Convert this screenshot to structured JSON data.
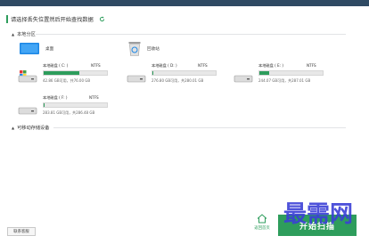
{
  "header": {
    "instruction": "请选择丢失位置然后开始查找数据",
    "refresh_icon": "refresh-icon"
  },
  "local_partitions": {
    "title": "本地分区",
    "items": [
      {
        "label": "桌面",
        "icon": "desktop-icon"
      },
      {
        "label": "回收站",
        "icon": "recycle-bin-icon"
      }
    ],
    "drives": [
      {
        "name": "本地磁盘 ( C: )",
        "fs": "NTFS",
        "usage_pct": 57,
        "size": "42.86 GB可用，共76.00 GB"
      },
      {
        "name": "本地磁盘 ( D: )",
        "fs": "NTFS",
        "usage_pct": 2,
        "size": "276.80 GB可用，共280.01 GB"
      },
      {
        "name": "本地磁盘 ( E: )",
        "fs": "NTFS",
        "usage_pct": 15,
        "size": "244.07 GB可用，共287.01 GB"
      },
      {
        "name": "本地磁盘 ( F: )",
        "fs": "NTFS",
        "usage_pct": 1,
        "size": "283.81 GB可用，共286.48 GB"
      }
    ]
  },
  "removable": {
    "title": "可移动存储设备"
  },
  "footer": {
    "left_button": "联系客服",
    "home_label": "返回首页",
    "start_button": "开始扫描"
  },
  "watermark": "最需网",
  "colors": {
    "accent": "#2e9d5c",
    "topbar": "#2f4a63",
    "watermark": "#3b3fd6"
  }
}
